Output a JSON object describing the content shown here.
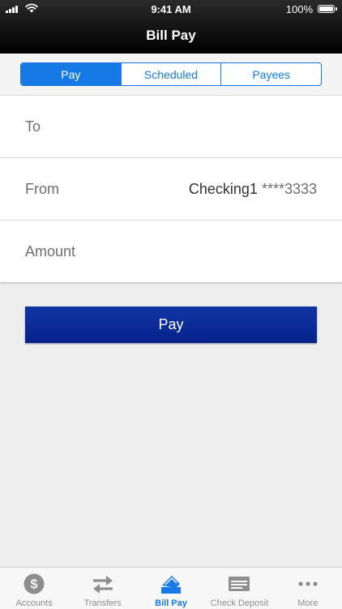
{
  "status_bar": {
    "time": "9:41 AM",
    "battery": "100%"
  },
  "nav": {
    "title": "Bill Pay"
  },
  "segments": [
    {
      "label": "Pay",
      "active": true
    },
    {
      "label": "Scheduled",
      "active": false
    },
    {
      "label": "Payees",
      "active": false
    }
  ],
  "form": {
    "to_label": "To",
    "from_label": "From",
    "from_account_name": "Checking1",
    "from_account_mask": "****3333",
    "amount_label": "Amount"
  },
  "pay_button": {
    "label": "Pay"
  },
  "tab_bar": {
    "items": [
      {
        "label": "Accounts",
        "icon": "dollar-circle-icon"
      },
      {
        "label": "Transfers",
        "icon": "transfer-arrows-icon"
      },
      {
        "label": "Bill Pay",
        "icon": "bill-pay-icon",
        "active": true
      },
      {
        "label": "Check Deposit",
        "icon": "check-icon"
      },
      {
        "label": "More",
        "icon": "more-dots-icon"
      }
    ]
  },
  "colors": {
    "accent": "#1679e6",
    "pay_button": "#0a2c97",
    "header": "#000000",
    "background": "#eeeeee"
  }
}
